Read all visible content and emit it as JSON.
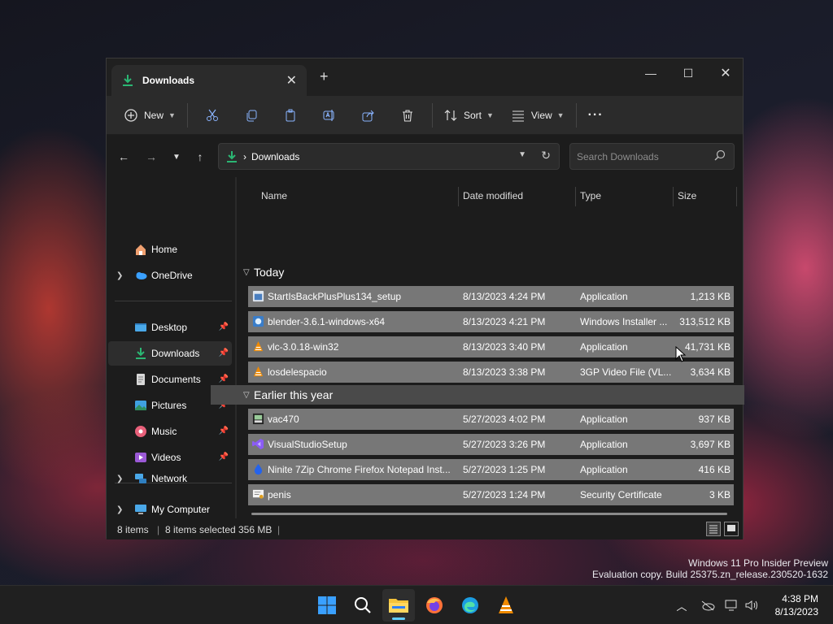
{
  "window": {
    "tab_title": "Downloads",
    "tab_close": "✕",
    "new_tab": "+",
    "minimize": "—",
    "maximize": "☐",
    "close": "✕"
  },
  "toolbar": {
    "new_label": "New",
    "sort_label": "Sort",
    "view_label": "View",
    "more_label": "···"
  },
  "address_bar": {
    "crumb_sep": "›",
    "crumb": "Downloads",
    "search_placeholder": "Search Downloads"
  },
  "nav": {
    "home": "Home",
    "onedrive": "OneDrive",
    "desktop": "Desktop",
    "downloads": "Downloads",
    "documents": "Documents",
    "pictures": "Pictures",
    "music": "Music",
    "videos": "Videos",
    "my_computer": "My Computer",
    "network": "Network"
  },
  "columns": {
    "name": "Name",
    "date": "Date modified",
    "type": "Type",
    "size": "Size"
  },
  "groups": [
    {
      "title": "Today",
      "files": [
        {
          "name": "StartIsBackPlusPlus134_setup",
          "date": "8/13/2023 4:24 PM",
          "type": "Application",
          "size": "1,213 KB",
          "icon": "installer-icon"
        },
        {
          "name": "blender-3.6.1-windows-x64",
          "date": "8/13/2023 4:21 PM",
          "type": "Windows Installer ...",
          "size": "313,512 KB",
          "icon": "msi-icon"
        },
        {
          "name": "vlc-3.0.18-win32",
          "date": "8/13/2023 3:40 PM",
          "type": "Application",
          "size": "41,731 KB",
          "icon": "vlc-icon"
        },
        {
          "name": "losdelespacio",
          "date": "8/13/2023 3:38 PM",
          "type": "3GP Video File (VL...",
          "size": "3,634 KB",
          "icon": "vlc-icon"
        }
      ]
    },
    {
      "title": "Earlier this year",
      "files": [
        {
          "name": "vac470",
          "date": "5/27/2023 4:02 PM",
          "type": "Application",
          "size": "937 KB",
          "icon": "app-icon"
        },
        {
          "name": "VisualStudioSetup",
          "date": "5/27/2023 3:26 PM",
          "type": "Application",
          "size": "3,697 KB",
          "icon": "visual-studio-icon"
        },
        {
          "name": "Ninite 7Zip Chrome Firefox Notepad Inst...",
          "date": "5/27/2023 1:25 PM",
          "type": "Application",
          "size": "416 KB",
          "icon": "ninite-icon"
        },
        {
          "name": "penis",
          "date": "5/27/2023 1:24 PM",
          "type": "Security Certificate",
          "size": "3 KB",
          "icon": "certificate-icon"
        }
      ]
    }
  ],
  "status": {
    "item_count": "8 items",
    "selected": "8 items selected",
    "selected_size": "356 MB",
    "sep": "|"
  },
  "watermark": {
    "line1": "Windows 11 Pro Insider Preview",
    "line2": "Evaluation copy. Build 25375.zn_release.230520-1632"
  },
  "clock": {
    "time": "4:38 PM",
    "date": "8/13/2023"
  },
  "colors": {
    "accent": "#60cdff",
    "selection_row": "#777777",
    "downloads_green": "#2bb673"
  }
}
